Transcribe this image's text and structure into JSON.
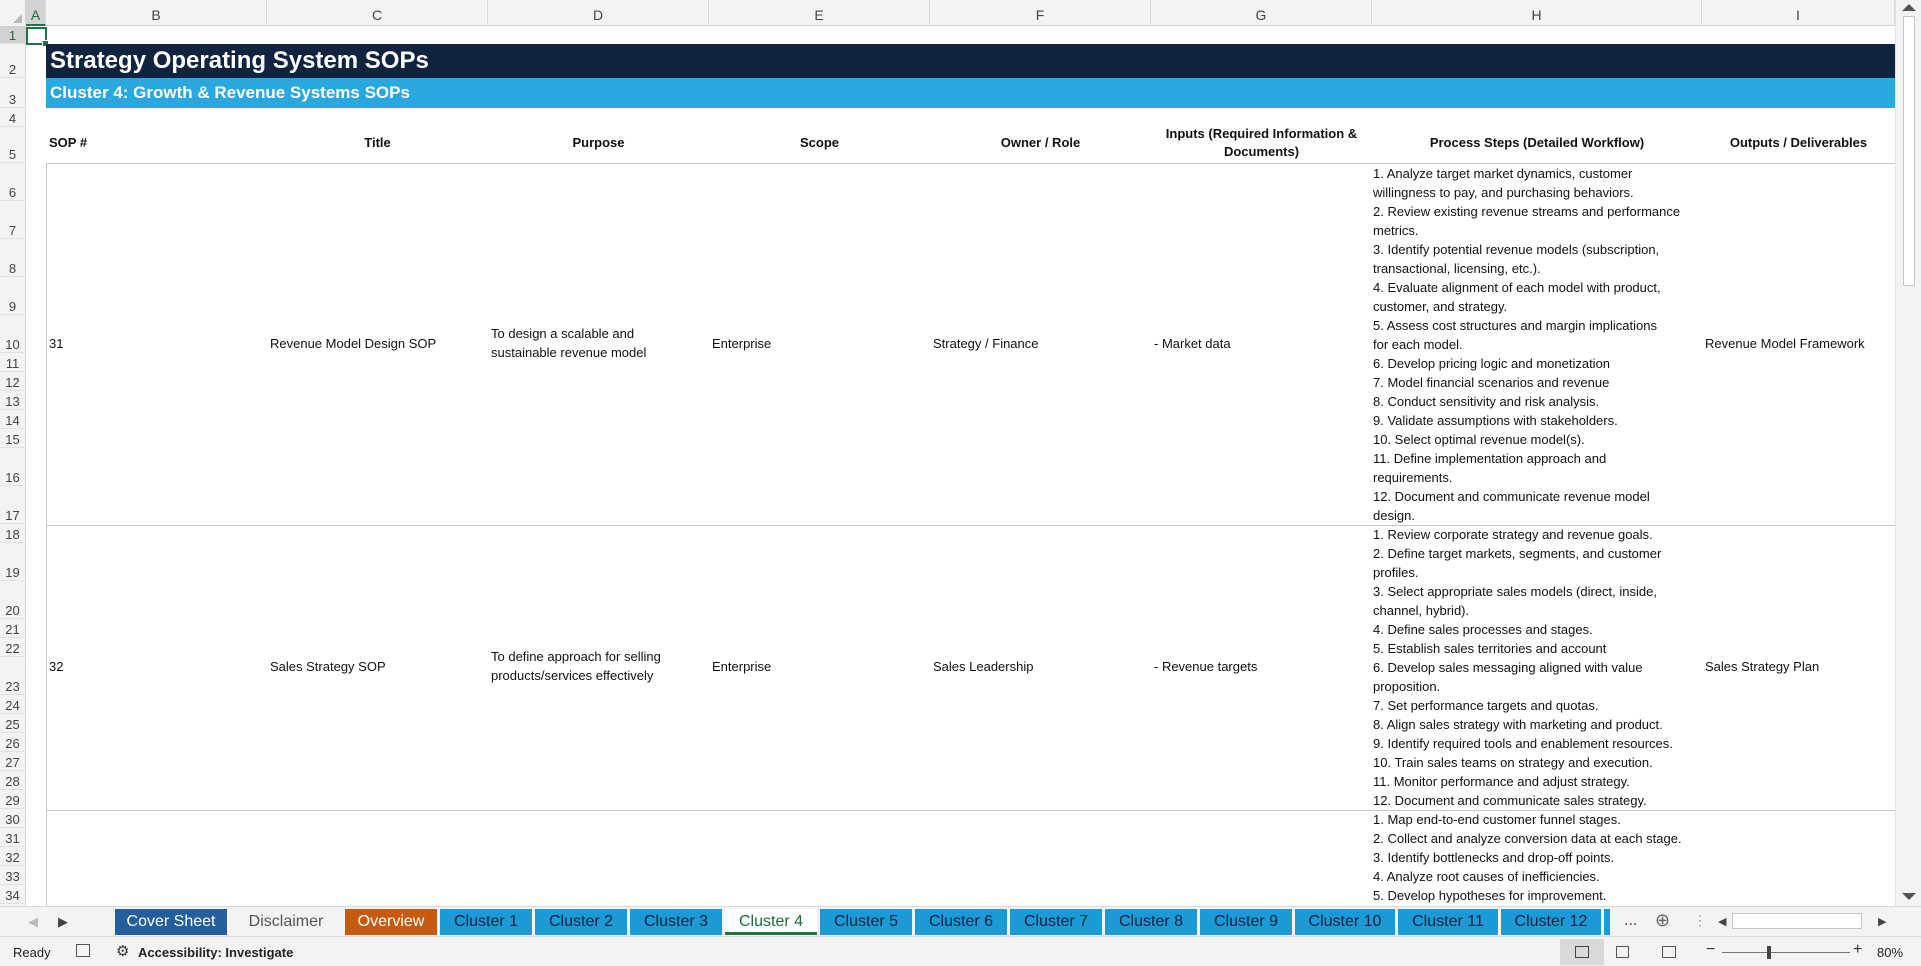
{
  "columns": [
    "A",
    "B",
    "C",
    "D",
    "E",
    "F",
    "G",
    "H",
    "I"
  ],
  "rows": [
    "1",
    "2",
    "3",
    "4",
    "5",
    "6",
    "7",
    "8",
    "9",
    "10",
    "11",
    "12",
    "13",
    "14",
    "15",
    "16",
    "17",
    "18",
    "19",
    "20",
    "21",
    "22",
    "23",
    "24",
    "25",
    "26",
    "27",
    "28",
    "29",
    "30",
    "31",
    "32",
    "33",
    "34"
  ],
  "sheet": {
    "title": "Strategy Operating System SOPs",
    "subtitle": "Cluster 4: Growth & Revenue Systems SOPs",
    "headers": {
      "sop": "SOP #",
      "title": "Title",
      "purpose": "Purpose",
      "scope": "Scope",
      "owner": "Owner / Role",
      "inputs": "Inputs (Required Information & Documents)",
      "steps": "Process Steps (Detailed Workflow)",
      "outputs": "Outputs / Deliverables"
    },
    "records": [
      {
        "sop": "31",
        "title": "Revenue Model Design SOP",
        "purpose": "To design a scalable and sustainable revenue model",
        "scope": "Enterprise",
        "owner": "Strategy / Finance",
        "inputs": "- Market data",
        "outputs": "Revenue Model Framework",
        "steps": [
          "1. Analyze target market dynamics, customer",
          "willingness to pay, and purchasing behaviors.",
          "2. Review existing revenue streams and performance",
          "metrics.",
          "3. Identify potential revenue models (subscription,",
          "transactional, licensing, etc.).",
          "4. Evaluate alignment of each model with product,",
          "customer, and strategy.",
          "5. Assess cost structures and margin implications",
          "for each model.",
          "6. Develop pricing logic and monetization",
          "7. Model financial scenarios and revenue",
          "8. Conduct sensitivity and risk analysis.",
          "9. Validate assumptions with stakeholders.",
          "10. Select optimal revenue model(s).",
          "11. Define implementation approach and",
          "requirements.",
          "12. Document and communicate revenue model",
          "design."
        ]
      },
      {
        "sop": "32",
        "title": "Sales Strategy SOP",
        "purpose": "To define approach for selling products/services effectively",
        "scope": "Enterprise",
        "owner": "Sales Leadership",
        "inputs": "- Revenue targets",
        "outputs": "Sales Strategy Plan",
        "steps": [
          "1. Review corporate strategy and revenue goals.",
          "2. Define target markets, segments, and customer",
          "profiles.",
          "3. Select appropriate sales models (direct, inside,",
          "channel, hybrid).",
          "4. Define sales processes and stages.",
          "5. Establish sales territories and account",
          "6. Develop sales messaging aligned with value",
          "proposition.",
          "7. Set performance targets and quotas.",
          "8. Align sales strategy with marketing and product.",
          "9. Identify required tools and enablement resources.",
          "10. Train sales teams on strategy and execution.",
          "11. Monitor performance and adjust strategy.",
          "12. Document and communicate sales strategy."
        ]
      },
      {
        "steps": [
          "1. Map end-to-end customer funnel stages.",
          "2. Collect and analyze conversion data at each stage.",
          "3. Identify bottlenecks and drop-off points.",
          "4. Analyze root causes of inefficiencies.",
          "5. Develop hypotheses for improvement."
        ]
      }
    ]
  },
  "tabs": [
    {
      "label": "Cover Sheet",
      "style": "navy"
    },
    {
      "label": "Disclaimer",
      "style": "gray"
    },
    {
      "label": "Overview",
      "style": "orange"
    },
    {
      "label": "Cluster 1",
      "style": "blue"
    },
    {
      "label": "Cluster 2",
      "style": "blue"
    },
    {
      "label": "Cluster 3",
      "style": "blue"
    },
    {
      "label": "Cluster 4",
      "style": "active"
    },
    {
      "label": "Cluster 5",
      "style": "blue"
    },
    {
      "label": "Cluster 6",
      "style": "blue"
    },
    {
      "label": "Cluster 7",
      "style": "blue"
    },
    {
      "label": "Cluster 8",
      "style": "blue"
    },
    {
      "label": "Cluster 9",
      "style": "blue"
    },
    {
      "label": "Cluster 10",
      "style": "blue"
    },
    {
      "label": "Cluster 11",
      "style": "blue"
    },
    {
      "label": "Cluster 12",
      "style": "blue"
    }
  ],
  "tab_overflow": "...",
  "status": {
    "ready": "Ready",
    "accessibility": "Accessibility: Investigate",
    "zoom": "80%"
  },
  "colors": {
    "title_band": "#10243f",
    "subtitle_band": "#29a8e0",
    "selection": "#217346"
  }
}
